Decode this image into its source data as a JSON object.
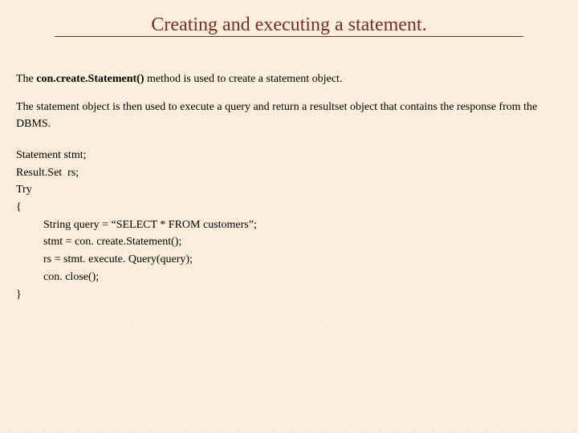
{
  "title": "Creating and executing a statement.",
  "para1_prefix": "The ",
  "para1_bold": "con.create.Statement()",
  "para1_suffix": " method is used to create a statement  object.",
  "para2": "The statement object is then  used to execute a query and return a resultset object that contains the response from the DBMS.",
  "code": {
    "l1": "Statement stmt;",
    "l2": "Result.Set  rs;",
    "l3": "Try",
    "l4": "{",
    "l5": "String query = “SELECT * FROM customers”;",
    "l6": "stmt = con. create.Statement();",
    "l7": "rs = stmt. execute. Query(query);",
    "l8": "con. close();",
    "l9": "}"
  }
}
